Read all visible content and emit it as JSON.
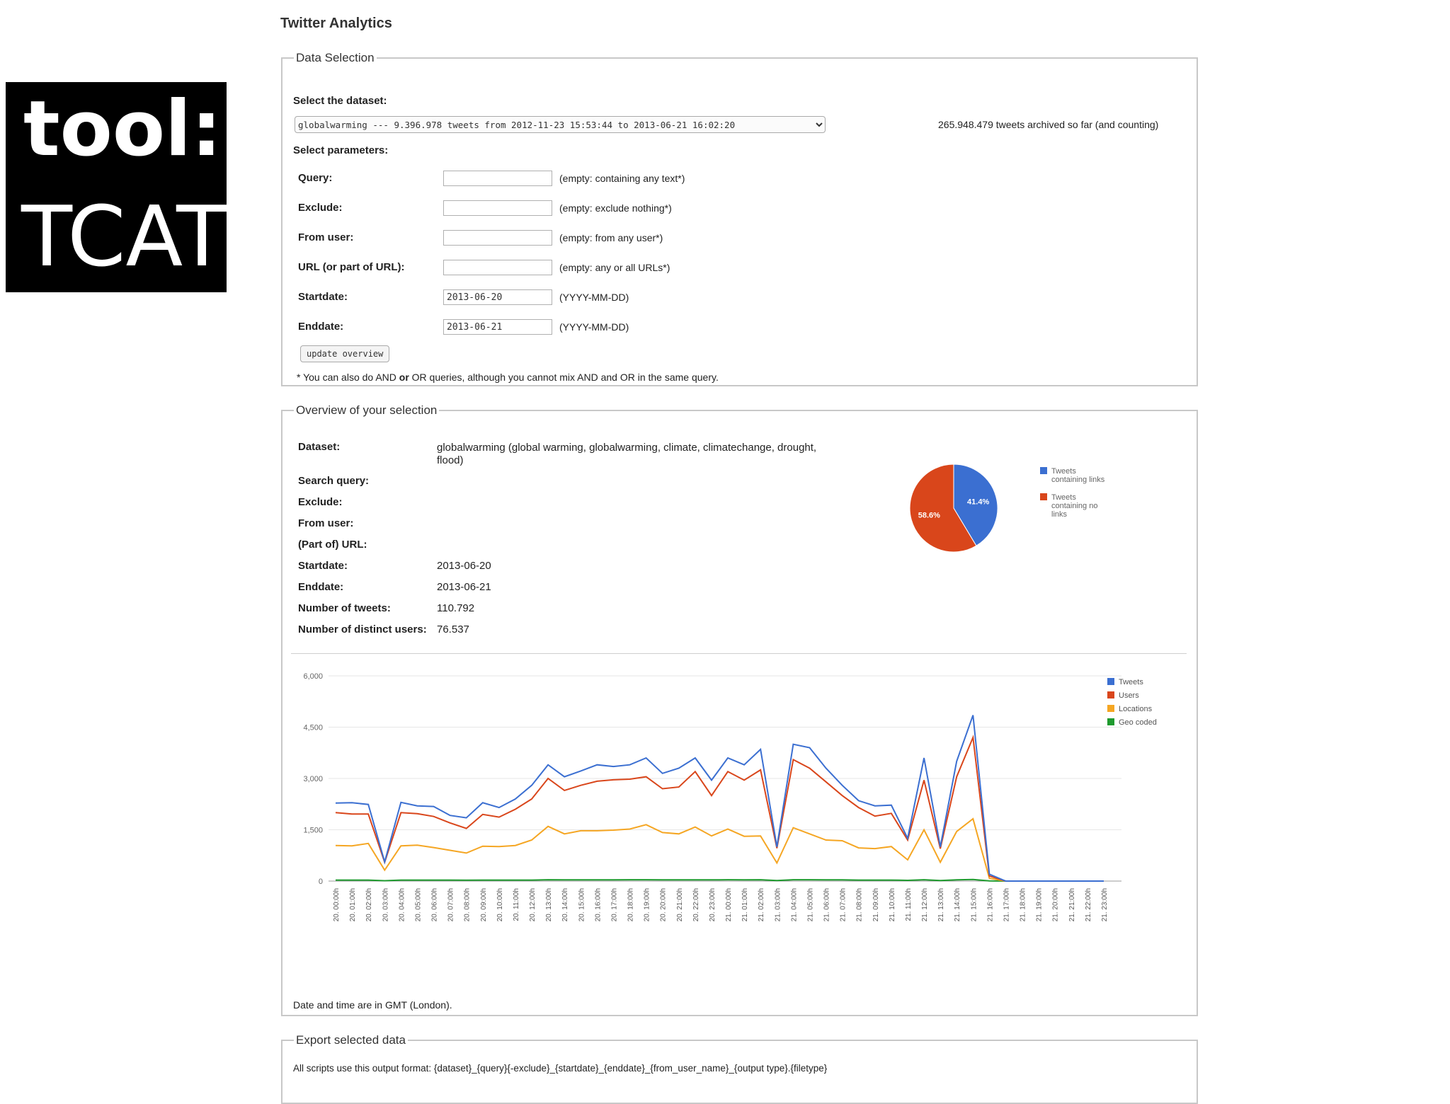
{
  "badge": {
    "line1": "tool:",
    "line2": "TCAT"
  },
  "app": {
    "title": "Twitter Analytics"
  },
  "data_selection": {
    "legend": "Data Selection",
    "select_dataset_label": "Select the dataset:",
    "dataset_selected": "globalwarming --- 9.396.978 tweets from 2012-11-23 15:53:44 to 2013-06-21 16:02:20",
    "archived_note": "265.948.479 tweets archived so far (and counting)",
    "select_parameters_label": "Select parameters:",
    "fields": [
      {
        "label": "Query:",
        "value": "",
        "hint": "(empty: containing any text*)"
      },
      {
        "label": "Exclude:",
        "value": "",
        "hint": "(empty: exclude nothing*)"
      },
      {
        "label": "From user:",
        "value": "",
        "hint": "(empty: from any user*)"
      },
      {
        "label": "URL (or part of URL):",
        "value": "",
        "hint": "(empty: any or all URLs*)"
      },
      {
        "label": "Startdate:",
        "value": "2013-06-20",
        "hint": "(YYYY-MM-DD)"
      },
      {
        "label": "Enddate:",
        "value": "2013-06-21",
        "hint": "(YYYY-MM-DD)"
      }
    ],
    "update_button": "update overview",
    "footnote_a": "* You can also do AND ",
    "footnote_b": "or",
    "footnote_c": " OR queries, although you cannot mix AND and OR in the same query."
  },
  "overview": {
    "legend": "Overview of your selection",
    "rows": [
      {
        "label": "Dataset:",
        "value": "globalwarming (global warming, globalwarming, climate, climatechange, drought, flood)"
      },
      {
        "label": "Search query:",
        "value": ""
      },
      {
        "label": "Exclude:",
        "value": ""
      },
      {
        "label": "From user:",
        "value": ""
      },
      {
        "label": "(Part of) URL:",
        "value": ""
      },
      {
        "label": "Startdate:",
        "value": "2013-06-20"
      },
      {
        "label": "Enddate:",
        "value": "2013-06-21"
      },
      {
        "label": "Number of tweets:",
        "value": "110.792"
      },
      {
        "label": "Number of distinct users:",
        "value": "76.537"
      }
    ],
    "footnote": "Date and time are in GMT (London)."
  },
  "export": {
    "legend": "Export selected data",
    "text": "All scripts use this output format: {dataset}_{query}{-exclude}_{startdate}_{enddate}_{from_user_name}_{output type}.{filetype}"
  },
  "colors": {
    "tweets": "#3b6fd1",
    "users": "#d9461b",
    "locations": "#f5a623",
    "geo": "#1e9a2e",
    "grid": "#e6e6e6"
  },
  "chart_data": [
    {
      "type": "pie",
      "slices": [
        {
          "label": "Tweets containing links",
          "value": 41.4,
          "display": "41.4%",
          "color": "#3b6fd1"
        },
        {
          "label": "Tweets containing no links",
          "value": 58.6,
          "display": "58.6%",
          "color": "#d9461b"
        }
      ],
      "legend_position": "right"
    },
    {
      "type": "line",
      "ylim": [
        0,
        6000
      ],
      "yticks": [
        0,
        1500,
        3000,
        4500,
        6000
      ],
      "ytick_labels": [
        "0",
        "1,500",
        "3,000",
        "4,500",
        "6,000"
      ],
      "grid": true,
      "legend_position": "top-right",
      "x": [
        "20. 00:00h",
        "20. 01:00h",
        "20. 02:00h",
        "20. 03:00h",
        "20. 04:00h",
        "20. 05:00h",
        "20. 06:00h",
        "20. 07:00h",
        "20. 08:00h",
        "20. 09:00h",
        "20. 10:00h",
        "20. 11:00h",
        "20. 12:00h",
        "20. 13:00h",
        "20. 14:00h",
        "20. 15:00h",
        "20. 16:00h",
        "20. 17:00h",
        "20. 18:00h",
        "20. 19:00h",
        "20. 20:00h",
        "20. 21:00h",
        "20. 22:00h",
        "20. 23:00h",
        "21. 00:00h",
        "21. 01:00h",
        "21. 02:00h",
        "21. 03:00h",
        "21. 04:00h",
        "21. 05:00h",
        "21. 06:00h",
        "21. 07:00h",
        "21. 08:00h",
        "21. 09:00h",
        "21. 10:00h",
        "21. 11:00h",
        "21. 12:00h",
        "21. 13:00h",
        "21. 14:00h",
        "21. 15:00h",
        "21. 16:00h",
        "21. 17:00h",
        "21. 18:00h",
        "21. 19:00h",
        "21. 20:00h",
        "21. 21:00h",
        "21. 22:00h",
        "21. 23:00h"
      ],
      "series": [
        {
          "name": "Tweets",
          "color": "#3b6fd1",
          "values": [
            2280,
            2290,
            2240,
            560,
            2300,
            2200,
            2180,
            1920,
            1850,
            2290,
            2150,
            2400,
            2800,
            3400,
            3050,
            3220,
            3400,
            3350,
            3400,
            3600,
            3150,
            3300,
            3600,
            2950,
            3600,
            3400,
            3850,
            1000,
            4000,
            3900,
            3300,
            2800,
            2350,
            2200,
            2220,
            1250,
            3600,
            1000,
            3500,
            4850,
            200,
            0,
            0,
            0,
            0,
            0,
            0,
            0
          ]
        },
        {
          "name": "Users",
          "color": "#d9461b",
          "values": [
            2000,
            1960,
            1960,
            550,
            2000,
            1970,
            1890,
            1700,
            1540,
            1950,
            1870,
            2100,
            2400,
            3000,
            2650,
            2800,
            2920,
            2960,
            2980,
            3050,
            2700,
            2750,
            3200,
            2500,
            3200,
            2950,
            3250,
            960,
            3550,
            3300,
            2900,
            2500,
            2150,
            1900,
            1980,
            1200,
            2950,
            950,
            3050,
            4200,
            150,
            0,
            0,
            0,
            0,
            0,
            0,
            0
          ]
        },
        {
          "name": "Locations",
          "color": "#f5a623",
          "values": [
            1040,
            1030,
            1100,
            320,
            1030,
            1050,
            980,
            900,
            820,
            1020,
            1010,
            1040,
            1200,
            1600,
            1380,
            1470,
            1470,
            1490,
            1520,
            1650,
            1420,
            1380,
            1580,
            1320,
            1520,
            1310,
            1320,
            530,
            1560,
            1380,
            1200,
            1180,
            970,
            950,
            1010,
            620,
            1500,
            550,
            1450,
            1820,
            80,
            0,
            0,
            0,
            0,
            0,
            0,
            0
          ]
        },
        {
          "name": "Geo coded",
          "color": "#1e9a2e",
          "values": [
            30,
            30,
            30,
            10,
            30,
            30,
            30,
            30,
            25,
            30,
            30,
            30,
            30,
            40,
            35,
            35,
            35,
            35,
            40,
            40,
            35,
            35,
            35,
            35,
            40,
            35,
            40,
            15,
            40,
            40,
            35,
            35,
            30,
            30,
            30,
            20,
            40,
            15,
            35,
            45,
            5,
            0,
            0,
            0,
            0,
            0,
            0,
            0
          ]
        }
      ]
    }
  ]
}
